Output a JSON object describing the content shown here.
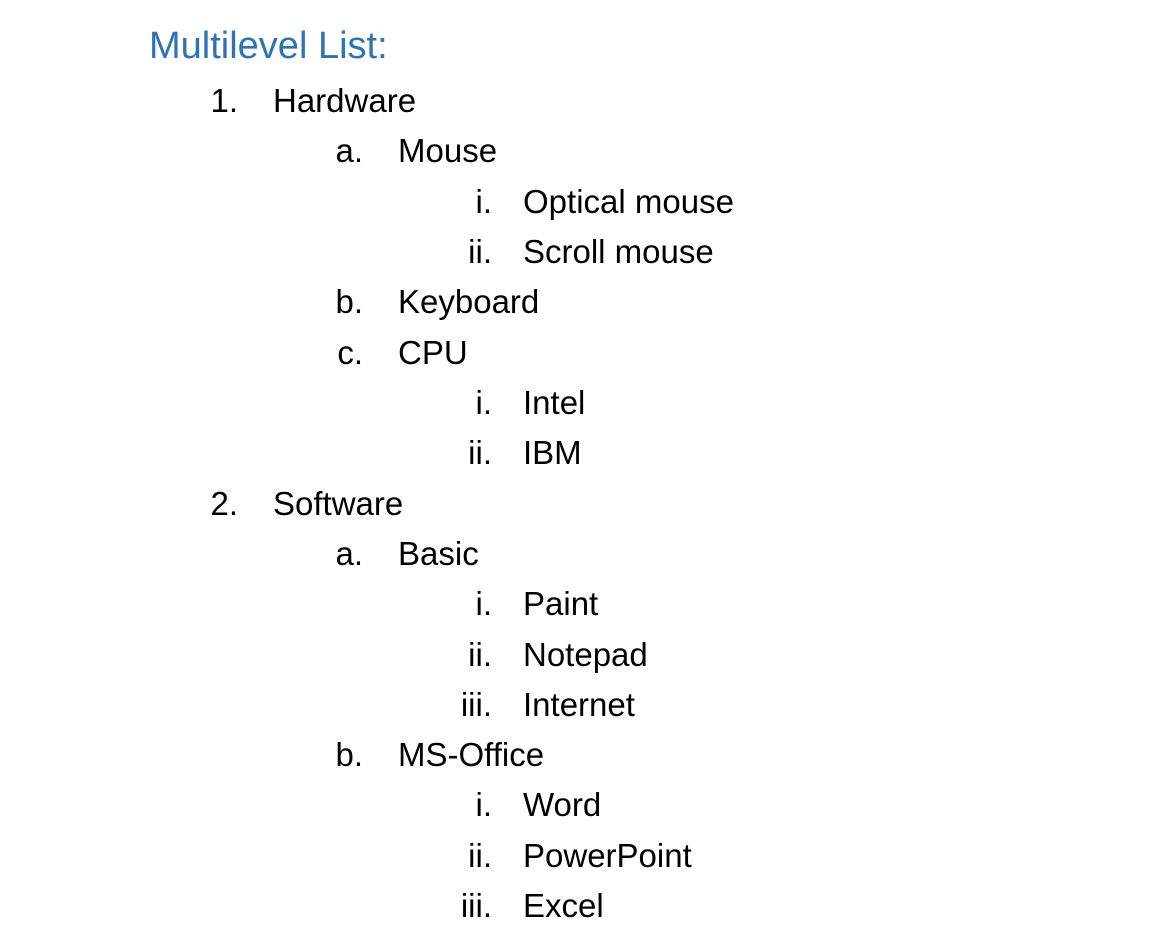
{
  "heading": "Multilevel List:",
  "items": [
    {
      "marker": "1.",
      "text": "Hardware"
    },
    {
      "marker": "a.",
      "text": "Mouse"
    },
    {
      "marker": "i.",
      "text": "Optical mouse"
    },
    {
      "marker": "ii.",
      "text": "Scroll mouse"
    },
    {
      "marker": "b.",
      "text": "Keyboard"
    },
    {
      "marker": "c.",
      "text": "CPU"
    },
    {
      "marker": "i.",
      "text": "Intel"
    },
    {
      "marker": "ii.",
      "text": "IBM"
    },
    {
      "marker": "2.",
      "text": "Software"
    },
    {
      "marker": "a.",
      "text": "Basic"
    },
    {
      "marker": "i.",
      "text": "Paint"
    },
    {
      "marker": "ii.",
      "text": "Notepad"
    },
    {
      "marker": "iii.",
      "text": "Internet"
    },
    {
      "marker": "b.",
      "text": "MS-Office"
    },
    {
      "marker": "i.",
      "text": "Word"
    },
    {
      "marker": "ii.",
      "text": "PowerPoint"
    },
    {
      "marker": "iii.",
      "text": "Excel"
    }
  ],
  "colors": {
    "heading": "#2e74b5",
    "body_text": "#000000",
    "background": "#ffffff"
  }
}
